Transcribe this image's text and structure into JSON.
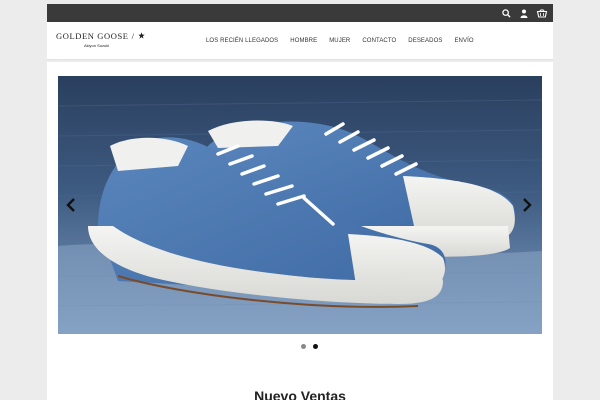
{
  "brand": {
    "name": "GOLDEN GOOSE",
    "separator": "/",
    "subtitle": "Akiyon Suzuki"
  },
  "topbar": {
    "icons": [
      "search-icon",
      "user-icon",
      "cart-icon"
    ]
  },
  "nav": {
    "items": [
      "LOS RECIÉN LLEGADOS",
      "HOMBRE",
      "MUJER",
      "CONTACTO",
      "DESEADOS",
      "ENVÍO"
    ]
  },
  "slider": {
    "slides": 2,
    "active_slide": 2,
    "image": "denim-sneakers-photo"
  },
  "section": {
    "title": "Nuevo Ventas"
  },
  "colors": {
    "topbar": "#3a3a3a",
    "denim": "#3d5f86",
    "accent": "#111111"
  }
}
